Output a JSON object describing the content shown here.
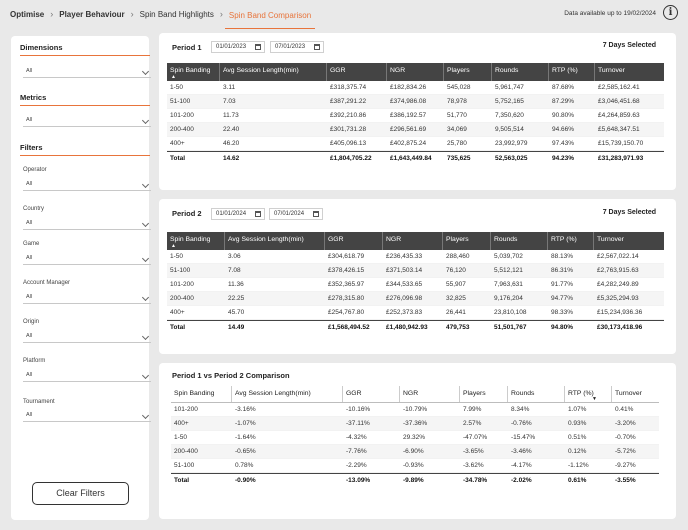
{
  "breadcrumb": [
    "Optimise",
    "Player Behaviour",
    "Spin Band Highlights",
    "Spin Band Comparison"
  ],
  "data_note": "Data available up to 19/02/2024",
  "info_icon": "info-icon",
  "accent_color": "#e8743b",
  "sidebar": {
    "dimensions_title": "Dimensions",
    "dimensions_value": "All",
    "metrics_title": "Metrics",
    "metrics_value": "All",
    "filters_title": "Filters",
    "filters": [
      {
        "label": "Operator",
        "value": "All"
      },
      {
        "label": "Country",
        "value": "All"
      },
      {
        "label": "Game",
        "value": "All"
      },
      {
        "label": "Account Manager",
        "value": "All"
      },
      {
        "label": "Origin",
        "value": "All"
      },
      {
        "label": "Platform",
        "value": "All"
      },
      {
        "label": "Tournament",
        "value": "All"
      }
    ],
    "clear_label": "Clear Filters"
  },
  "period1": {
    "title": "Period 1",
    "start": "01/01/2023",
    "end": "07/01/2023",
    "days_selected": "7 Days Selected",
    "headers": [
      "Spin Banding",
      "Avg Session Length(min)",
      "GGR",
      "NGR",
      "Players",
      "Rounds",
      "RTP (%)",
      "Turnover"
    ],
    "rows": [
      [
        "1-50",
        "3.11",
        "£318,375.74",
        "£182,834.26",
        "545,028",
        "5,961,747",
        "87.68%",
        "£2,585,162.41"
      ],
      [
        "51-100",
        "7.03",
        "£387,291.22",
        "£374,986.08",
        "78,978",
        "5,752,165",
        "87.29%",
        "£3,046,451.68"
      ],
      [
        "101-200",
        "11.73",
        "£392,210.86",
        "£386,192.57",
        "51,770",
        "7,350,620",
        "90.80%",
        "£4,264,859.63"
      ],
      [
        "200-400",
        "22.40",
        "£301,731.28",
        "£296,561.69",
        "34,069",
        "9,505,514",
        "94.66%",
        "£5,648,347.51"
      ],
      [
        "400+",
        "46.20",
        "£405,096.13",
        "£402,875.24",
        "25,780",
        "23,992,979",
        "97.43%",
        "£15,739,150.70"
      ]
    ],
    "total": [
      "Total",
      "14.62",
      "£1,804,705.22",
      "£1,643,449.84",
      "735,625",
      "52,563,025",
      "94.23%",
      "£31,283,971.93"
    ]
  },
  "period2": {
    "title": "Period 2",
    "start": "01/01/2024",
    "end": "07/01/2024",
    "days_selected": "7 Days Selected",
    "headers": [
      "Spin Banding",
      "Avg Session Length(min)",
      "GGR",
      "NGR",
      "Players",
      "Rounds",
      "RTP (%)",
      "Turnover"
    ],
    "rows": [
      [
        "1-50",
        "3.06",
        "£304,618.79",
        "£236,435.33",
        "288,460",
        "5,039,702",
        "88.13%",
        "£2,567,022.14"
      ],
      [
        "51-100",
        "7.08",
        "£378,426.15",
        "£371,503.14",
        "76,120",
        "5,512,121",
        "86.31%",
        "£2,763,915.63"
      ],
      [
        "101-200",
        "11.36",
        "£352,365.97",
        "£344,533.65",
        "55,907",
        "7,963,631",
        "91.77%",
        "£4,282,249.89"
      ],
      [
        "200-400",
        "22.25",
        "£278,315.80",
        "£276,096.98",
        "32,825",
        "9,176,204",
        "94.77%",
        "£5,325,294.93"
      ],
      [
        "400+",
        "45.70",
        "£254,767.80",
        "£252,373.83",
        "26,441",
        "23,810,108",
        "98.33%",
        "£15,234,936.36"
      ]
    ],
    "total": [
      "Total",
      "14.49",
      "£1,568,494.52",
      "£1,480,942.93",
      "479,753",
      "51,501,767",
      "94.80%",
      "£30,173,418.96"
    ]
  },
  "comparison": {
    "title": "Period 1 vs Period 2 Comparison",
    "headers": [
      "Spin Banding",
      "Avg Session Length(min)",
      "GGR",
      "NGR",
      "Players",
      "Rounds",
      "RTP (%)",
      "Turnover"
    ],
    "rows": [
      [
        "101-200",
        "-3.16%",
        "-10.16%",
        "-10.79%",
        "7.99%",
        "8.34%",
        "1.07%",
        "0.41%"
      ],
      [
        "400+",
        "-1.07%",
        "-37.11%",
        "-37.36%",
        "2.57%",
        "-0.76%",
        "0.93%",
        "-3.20%"
      ],
      [
        "1-50",
        "-1.64%",
        "-4.32%",
        "29.32%",
        "-47.07%",
        "-15.47%",
        "0.51%",
        "-0.70%"
      ],
      [
        "200-400",
        "-0.65%",
        "-7.76%",
        "-6.90%",
        "-3.65%",
        "-3.46%",
        "0.12%",
        "-5.72%"
      ],
      [
        "51-100",
        "0.78%",
        "-2.29%",
        "-0.93%",
        "-3.62%",
        "-4.17%",
        "-1.12%",
        "-9.27%"
      ]
    ],
    "total": [
      "Total",
      "-0.90%",
      "-13.09%",
      "-9.89%",
      "-34.78%",
      "-2.02%",
      "0.61%",
      "-3.55%"
    ]
  }
}
